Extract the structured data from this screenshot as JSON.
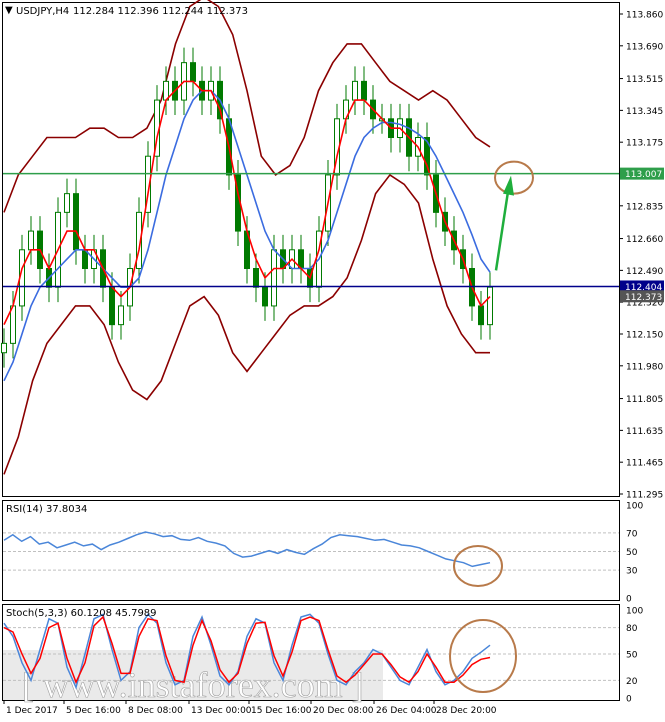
{
  "header": {
    "symbol": "USDJPY,H4",
    "ohlc": "112.284 112.396 112.244 112.373"
  },
  "watermark": "[ www.instaforex.com ]",
  "colors": {
    "candle": "#007a00",
    "ma_fast": "#ff0000",
    "ma_slow": "#3b6ce0",
    "bollinger": "#8b0000",
    "resistance": "#2e9e4a",
    "support": "#00008b",
    "annotation": "#b87a4a",
    "arrow": "#1fae3c",
    "rsi": "#4a86d9",
    "stoch_main": "#4a86d9",
    "stoch_signal": "#ff0000"
  },
  "chart_data": {
    "type": "line",
    "price_axis": {
      "ticks": [
        "113.860",
        "113.690",
        "113.515",
        "113.345",
        "113.175",
        "113.007",
        "112.835",
        "112.660",
        "112.490",
        "112.404",
        "112.373",
        "112.320",
        "112.150",
        "111.980",
        "111.805",
        "111.635",
        "111.465",
        "111.295"
      ],
      "ylim": [
        111.295,
        113.86
      ]
    },
    "levels": {
      "resistance": {
        "value": 113.007,
        "label": "113.007"
      },
      "support": {
        "value": 112.404,
        "label": "112.404"
      },
      "current": {
        "value": 112.373,
        "label": "112.373"
      }
    },
    "x_labels": [
      "1 Dec 2017",
      "5 Dec 16:00",
      "8 Dec 08:00",
      "13 Dec 00:00",
      "15 Dec 16:00",
      "20 Dec 08:00",
      "26 Dec 04:00",
      "28 Dec 20:00"
    ],
    "close": [
      112.1,
      112.3,
      112.6,
      112.7,
      112.5,
      112.4,
      112.8,
      112.9,
      112.6,
      112.5,
      112.6,
      112.4,
      112.2,
      112.3,
      112.5,
      112.8,
      113.1,
      113.4,
      113.5,
      113.4,
      113.6,
      113.5,
      113.4,
      113.5,
      113.3,
      113.0,
      112.7,
      112.5,
      112.4,
      112.3,
      112.6,
      112.5,
      112.6,
      112.5,
      112.4,
      112.7,
      113.0,
      113.3,
      113.4,
      113.5,
      113.4,
      113.3,
      113.3,
      113.2,
      113.3,
      113.1,
      113.2,
      113.0,
      112.8,
      112.7,
      112.6,
      112.5,
      112.3,
      112.2,
      112.4
    ],
    "ma_fast": [
      112.2,
      112.3,
      112.5,
      112.6,
      112.6,
      112.5,
      112.6,
      112.7,
      112.7,
      112.6,
      112.6,
      112.5,
      112.4,
      112.35,
      112.4,
      112.6,
      112.9,
      113.2,
      113.4,
      113.45,
      113.5,
      113.5,
      113.45,
      113.45,
      113.35,
      113.15,
      112.9,
      112.7,
      112.55,
      112.45,
      112.5,
      112.5,
      112.55,
      112.5,
      112.45,
      112.6,
      112.85,
      113.1,
      113.3,
      113.4,
      113.4,
      113.35,
      113.3,
      113.25,
      113.25,
      113.2,
      113.15,
      113.05,
      112.9,
      112.75,
      112.65,
      112.55,
      112.4,
      112.3,
      112.35
    ],
    "ma_slow": [
      111.9,
      112.0,
      112.15,
      112.3,
      112.4,
      112.45,
      112.5,
      112.55,
      112.6,
      112.6,
      112.55,
      112.5,
      112.45,
      112.4,
      112.4,
      112.45,
      112.6,
      112.8,
      113.0,
      113.15,
      113.3,
      113.4,
      113.45,
      113.45,
      113.4,
      113.3,
      113.15,
      113.0,
      112.85,
      112.7,
      112.6,
      112.55,
      112.5,
      112.5,
      112.5,
      112.55,
      112.65,
      112.8,
      112.95,
      113.1,
      113.2,
      113.25,
      113.28,
      113.28,
      113.27,
      113.25,
      113.22,
      113.18,
      113.1,
      113.0,
      112.9,
      112.8,
      112.68,
      112.55,
      112.48
    ],
    "bb_upper": [
      112.8,
      113.0,
      113.1,
      113.2,
      113.2,
      113.2,
      113.25,
      113.25,
      113.2,
      113.2,
      113.25,
      113.4,
      113.7,
      113.9,
      113.95,
      113.9,
      113.75,
      113.45,
      113.1,
      113.0,
      113.05,
      113.2,
      113.45,
      113.6,
      113.7,
      113.7,
      113.6,
      113.5,
      113.45,
      113.4,
      113.45,
      113.4,
      113.3,
      113.2,
      113.15
    ],
    "bb_lower": [
      111.4,
      111.6,
      111.9,
      112.1,
      112.2,
      112.3,
      112.3,
      112.2,
      112.0,
      111.85,
      111.8,
      111.9,
      112.1,
      112.3,
      112.35,
      112.25,
      112.05,
      111.95,
      112.05,
      112.15,
      112.25,
      112.3,
      112.3,
      112.35,
      112.45,
      112.65,
      112.9,
      113.0,
      112.95,
      112.85,
      112.55,
      112.3,
      112.15,
      112.05,
      112.05
    ],
    "rsi": {
      "label": "RSI(14) 37.8034",
      "ticks": [
        "100",
        "70",
        "50",
        "30",
        "0"
      ],
      "levels": [
        70,
        50,
        30
      ],
      "ylim": [
        0,
        100
      ],
      "values": [
        62,
        68,
        61,
        66,
        58,
        60,
        54,
        57,
        60,
        56,
        58,
        52,
        57,
        60,
        64,
        68,
        71,
        69,
        66,
        67,
        63,
        62,
        65,
        61,
        59,
        56,
        48,
        44,
        45,
        48,
        51,
        48,
        52,
        49,
        47,
        53,
        58,
        65,
        68,
        67,
        66,
        64,
        62,
        63,
        60,
        57,
        56,
        54,
        50,
        46,
        42,
        40,
        38,
        34,
        36,
        38
      ]
    },
    "stoch": {
      "label": "Stoch(5,3,3) 60.1208 45.7989",
      "ticks": [
        "100",
        "80",
        "50",
        "20",
        "0"
      ],
      "levels": [
        80,
        50,
        20
      ],
      "ylim": [
        0,
        100
      ],
      "main": [
        85,
        70,
        40,
        20,
        55,
        90,
        85,
        35,
        12,
        50,
        90,
        95,
        55,
        20,
        30,
        80,
        95,
        85,
        40,
        15,
        20,
        70,
        92,
        60,
        25,
        15,
        30,
        70,
        90,
        85,
        40,
        20,
        60,
        92,
        95,
        85,
        50,
        20,
        15,
        30,
        40,
        55,
        50,
        35,
        20,
        15,
        35,
        55,
        30,
        15,
        20,
        30,
        45,
        52,
        60
      ],
      "signal": [
        80,
        75,
        50,
        28,
        45,
        80,
        85,
        45,
        18,
        40,
        82,
        92,
        62,
        28,
        28,
        70,
        90,
        88,
        48,
        20,
        18,
        60,
        88,
        65,
        32,
        18,
        28,
        62,
        85,
        86,
        48,
        25,
        52,
        88,
        92,
        88,
        55,
        25,
        18,
        26,
        38,
        50,
        50,
        38,
        24,
        18,
        30,
        50,
        35,
        18,
        18,
        26,
        38,
        44,
        46
      ]
    }
  }
}
